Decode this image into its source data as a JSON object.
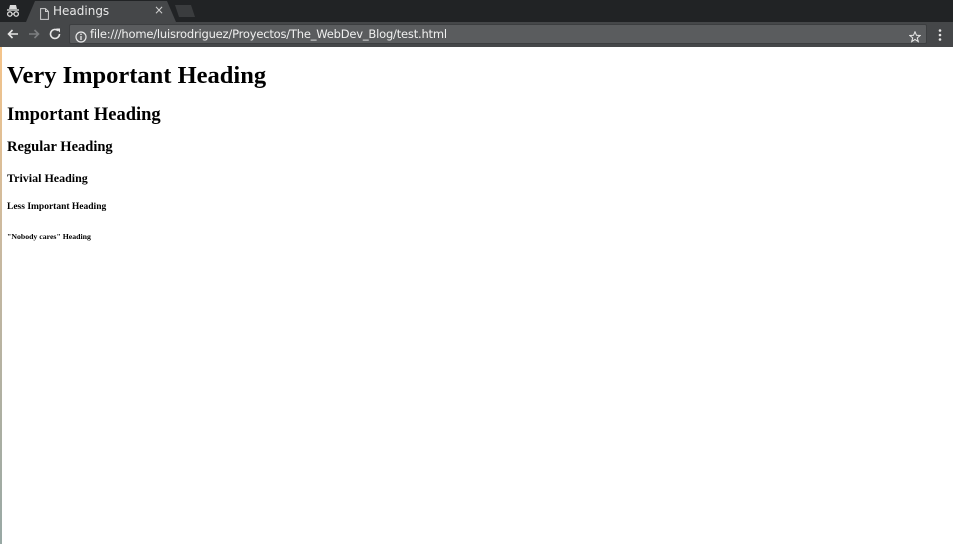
{
  "browser": {
    "tab": {
      "title": "Headings",
      "close_glyph": "×"
    },
    "icons": {
      "incognito": "incognito-icon",
      "page": "page-icon",
      "back": "back-arrow-icon",
      "forward": "forward-arrow-icon",
      "reload": "reload-icon",
      "info": "info-icon",
      "star": "star-icon",
      "menu": "kebab-menu-icon"
    },
    "address_bar": {
      "url": "file:///home/luisrodriguez/Proyectos/The_WebDev_Blog/test.html"
    }
  },
  "page": {
    "headings": {
      "h1": "Very Important Heading",
      "h2": "Important Heading",
      "h3": "Regular Heading",
      "h4": "Trivial Heading",
      "h5": "Less Important Heading",
      "h6": "\"Nobody cares\" Heading"
    }
  }
}
